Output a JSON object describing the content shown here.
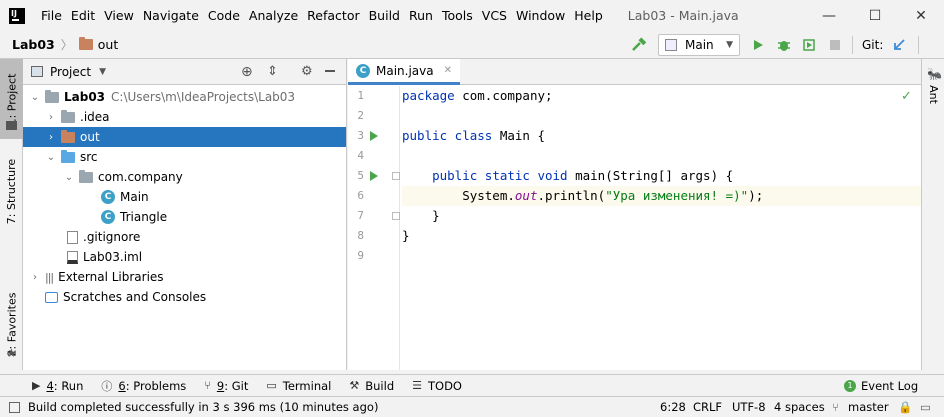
{
  "menu": {
    "items": [
      "File",
      "Edit",
      "View",
      "Navigate",
      "Code",
      "Analyze",
      "Refactor",
      "Build",
      "Run",
      "Tools",
      "VCS",
      "Window",
      "Help"
    ],
    "window_title": "Lab03 - Main.java"
  },
  "window_controls": {
    "minimize": "—",
    "maximize": "☐",
    "close": "✕"
  },
  "navbar": {
    "crumb_project": "Lab03",
    "crumb_folder": "out",
    "run_config": "Main",
    "git_label": "Git:"
  },
  "left_strip": {
    "project_tab": "1: Project",
    "structure_tab": "7: Structure",
    "favorites_tab": "2: Favorites"
  },
  "right_strip": {
    "ant_tab": "Ant"
  },
  "project_panel": {
    "title": "Project",
    "tree": [
      {
        "label": "Lab03",
        "path": "C:\\Users\\m\\IdeaProjects\\Lab03",
        "arrow": "⌄"
      },
      {
        "label": ".idea",
        "arrow": "›"
      },
      {
        "label": "out",
        "arrow": "›"
      },
      {
        "label": "src",
        "arrow": "⌄"
      },
      {
        "label": "com.company",
        "arrow": "⌄"
      },
      {
        "label": "Main"
      },
      {
        "label": "Triangle"
      },
      {
        "label": ".gitignore"
      },
      {
        "label": "Lab03.iml"
      },
      {
        "label": "External Libraries",
        "arrow": "›"
      },
      {
        "label": "Scratches and Consoles"
      }
    ]
  },
  "editor": {
    "tab_label": "Main.java",
    "line_numbers": [
      "1",
      "2",
      "3",
      "4",
      "5",
      "6",
      "7",
      "8",
      "9"
    ],
    "code": {
      "l1_kw": "package",
      "l1_rest": " com.company;",
      "l3_kw": "public class",
      "l3_rest": " Main {",
      "l5_indent": "    ",
      "l5_kw": "public static void",
      "l5_rest": " main(String[] args) {",
      "l6_indent": "        System.",
      "l6_field": "out",
      "l6_call": ".println(",
      "l6_str": "\"Ура изменения! =)\"",
      "l6_end": ");",
      "l7": "    }",
      "l8": "}"
    }
  },
  "bottom_tabs": [
    {
      "key": "4",
      "label": ": Run"
    },
    {
      "key": "6",
      "label": ": Problems"
    },
    {
      "key": "9",
      "label": ": Git"
    },
    {
      "label": "Terminal"
    },
    {
      "label": "Build"
    },
    {
      "label": "TODO"
    }
  ],
  "event_log": {
    "label": "Event Log",
    "count": "1"
  },
  "status": {
    "message": "Build completed successfully in 3 s 396 ms (10 minutes ago)",
    "position": "6:28",
    "line_sep": "CRLF",
    "encoding": "UTF-8",
    "indent": "4 spaces",
    "branch": "master"
  },
  "colors": {
    "accent": "#2675bf",
    "keyword": "#0033b3",
    "string": "#067d17",
    "run_green": "#4aa648"
  }
}
